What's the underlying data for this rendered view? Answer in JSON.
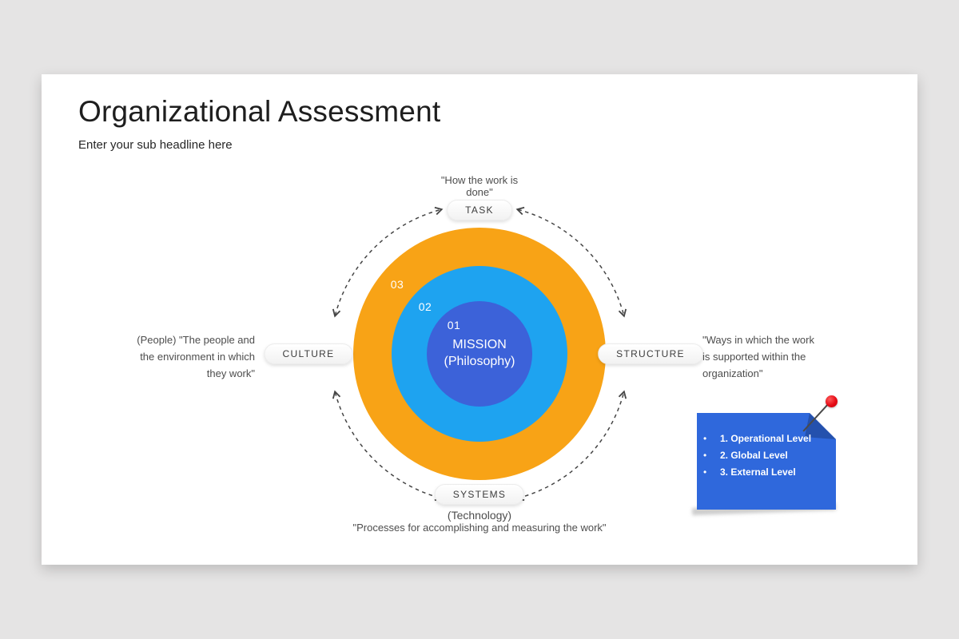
{
  "slide": {
    "title": "Organizational Assessment",
    "subtitle": "Enter your sub headline here"
  },
  "diagram": {
    "rings": {
      "outer": {
        "number": "03",
        "color": "#F8A316"
      },
      "middle": {
        "number": "02",
        "color": "#1EA3F0"
      },
      "core": {
        "number": "01",
        "color": "#3C62D9"
      }
    },
    "mission": {
      "line1": "MISSION",
      "line2": "(Philosophy)"
    },
    "task": {
      "label": "TASK",
      "desc_line1": "\"How the work is",
      "desc_line2": "done\""
    },
    "culture": {
      "label": "CULTURE",
      "desc_line1": "(People) \"The people and",
      "desc_line2": "the environment in which",
      "desc_line3": "they work\""
    },
    "structure": {
      "label": "STRUCTURE",
      "desc_line1": "\"Ways in which the work",
      "desc_line2": "is supported within the",
      "desc_line3": "organization\""
    },
    "systems": {
      "label": "SYSTEMS",
      "desc_line1": "(Technology)",
      "desc_line2": "\"Processes for accomplishing and measuring the work\""
    }
  },
  "note": {
    "color": "#2F68DC",
    "fold_color": "#2451AD",
    "pin_color": "#E50B15",
    "items": [
      "1. Operational Level",
      "2. Global Level",
      "3. External Level"
    ]
  }
}
